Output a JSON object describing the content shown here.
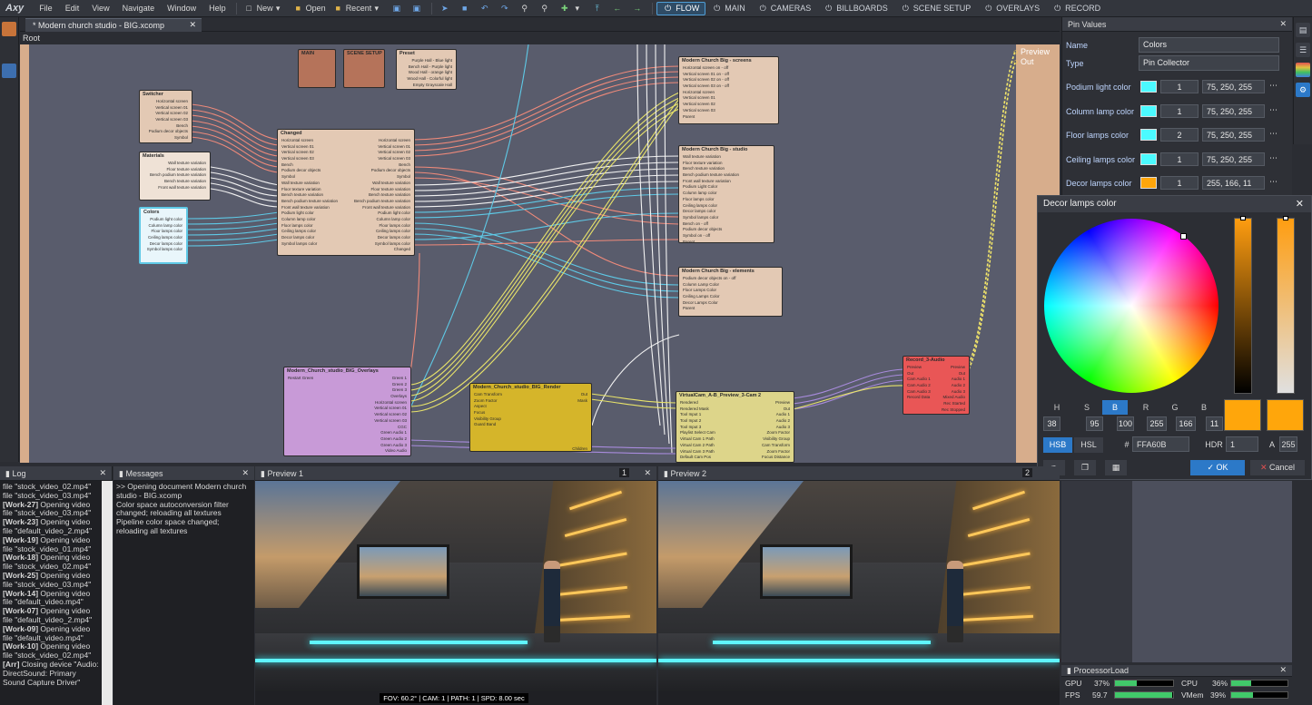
{
  "app": {
    "logo": "Axy"
  },
  "menu": [
    "File",
    "Edit",
    "View",
    "Navigate",
    "Window",
    "Help"
  ],
  "toolbar": {
    "new": "New",
    "open": "Open",
    "recent": "Recent"
  },
  "modes": [
    "FLOW",
    "MAIN",
    "CAMERAS",
    "BILLBOARDS",
    "SCENE SETUP",
    "OVERLAYS",
    "RECORD"
  ],
  "active_mode": "FLOW",
  "doc_tab": "* Modern church studio - BIG.xcomp",
  "breadcrumb": "Root",
  "flow": {
    "outputs": [
      "Preview",
      "Out"
    ],
    "nodes": {
      "main": "MAIN",
      "scene_setup": "SCENE SETUP",
      "preset": {
        "title": "Preset",
        "rows": [
          "Purple Hall - Blue light",
          "Bench Hall - Purple light",
          "Wood Hall - orange light",
          "Wood Hall - Colorful light",
          "Empty Grayscale Hall"
        ]
      },
      "switcher": {
        "title": "Switcher",
        "rows": [
          "Horizontal screen",
          "Vertical screen 01",
          "Vertical screen 02",
          "Vertical screen 03",
          "Bench",
          "Podium decor objects",
          "Symbol"
        ]
      },
      "materials": {
        "title": "Materials",
        "rows": [
          "Wall texture variation",
          "Floor texture variation",
          "Bench podium texture variation",
          "Bench texture variation",
          "Front wall texture variation"
        ]
      },
      "colors": {
        "title": "Colors",
        "rows": [
          "Podium light color",
          "Column lamp color",
          "Floor lamps color",
          "Ceiling lamps color",
          "Decor lamps color",
          "Symbol lamps color"
        ]
      },
      "changed": {
        "title": "Changed",
        "left": [
          "Horizontal screen",
          "Vertical screen 01",
          "Vertical screen 02",
          "Vertical screen 03",
          "Bench",
          "Podium decor objects",
          "Symbol",
          "Wall texture variation",
          "Floor texture variation",
          "Bench texture variation",
          "Bench podium texture variation",
          "Front wall texture variation",
          "Podium light color",
          "Column lamp color",
          "Floor lamps color",
          "Ceiling lamps color",
          "Decor lamps color",
          "Symbol lamps color"
        ],
        "right": [
          "Horizontal screen",
          "Vertical screen 01",
          "Vertical screen 02",
          "Vertical screen 03",
          "Bench",
          "Podium decor objects",
          "Symbol",
          "Wall texture variation",
          "Floor texture variation",
          "Bench texture variation",
          "Bench podium texture variation",
          "Front wall texture variation",
          "Podium light color",
          "Column lamp color",
          "Floor lamps color",
          "Ceiling lamps color",
          "Decor lamps color",
          "Symbol lamps color",
          "Changed"
        ]
      },
      "screens": {
        "title": "Modern Church Big - screens",
        "rows": [
          "Horizontal screen on - off",
          "Vertical screen 01 on - off",
          "Vertical screen 02 on - off",
          "Vertical screen 03 on - off",
          "Horizontal screen",
          "Vertical screen 01",
          "Vertical screen 02",
          "Vertical screen 03",
          "Parent"
        ]
      },
      "studio": {
        "title": "Modern Church Big - studio",
        "rows": [
          "Wall texture variation",
          "Floor texture variation",
          "Bench texture variation",
          "Bench podium texture variation",
          "Front wall texture variation",
          "Podium Light Color",
          "Column lamp color",
          "Floor lamps color",
          "Ceiling lamps color",
          "Decor lamps color",
          "Symbol lamps color",
          "Bench on - off",
          "Podium decor objects",
          "Symbol on - off",
          "Parent"
        ]
      },
      "elements": {
        "title": "Modern Church Big - elements",
        "rows": [
          "Podium decor objects on - off",
          "Column Lamp Color",
          "Floor Lamps Color",
          "Ceiling Lamps Color",
          "Decor Lamps Color",
          "Parent"
        ]
      },
      "overlays": {
        "title": "Modern_Church_studio_BIG_Overlays",
        "left": [
          "Restart Green"
        ],
        "right": [
          "Green 1",
          "Green 2",
          "Green 3",
          "Overlays",
          "Horizontal screen",
          "Vertical screen 01",
          "Vertical screen 02",
          "Vertical screen 03",
          "CGC",
          "Green Audio 1",
          "Green Audio 2",
          "Green Audio 3",
          "Video Audio"
        ]
      },
      "render": {
        "title": "Modern_Church_studio_BIG_Render",
        "left": [
          "Cam Transform",
          "Zoom Factor",
          "Aspect",
          "Focus",
          "Visibility Group",
          "Guard Band"
        ],
        "right": [
          "Out",
          "Mask",
          "",
          "",
          "",
          "",
          "",
          "",
          "",
          "Children",
          "Bindings",
          "Affecting Lights"
        ]
      },
      "vcam": {
        "title": "VirtualCam_A-B_Preview_3-Cam 2",
        "left": [
          "Rendered",
          "Rendered Mask",
          "Tool Input 1",
          "Tool Input 2",
          "Tool Input 3",
          "Playlist Select Cam",
          "Virtual Cam 1 Path",
          "Virtual Cam 2 Path",
          "Virtual Cam 3 Path",
          "Default Cam Pos"
        ],
        "right": [
          "Preview",
          "Out",
          "Audio 1",
          "Audio 2",
          "Audio 3",
          "Zoom Factor",
          "Visibility Group",
          "Cam Transform",
          "Zoom Factor",
          "Focus Distance"
        ]
      },
      "record": {
        "title": "Record_3-Audio",
        "left": [
          "Preview",
          "Out",
          "Cam Audio 1",
          "Cam Audio 2",
          "Cam Audio 3",
          "Record Data"
        ],
        "right": [
          "Preview",
          "Out",
          "Audio 1",
          "Audio 2",
          "Audio 3",
          "Mixed Audio",
          "Rec Started",
          "Rec Stopped"
        ]
      }
    }
  },
  "pin_values": {
    "title": "Pin Values",
    "name_label": "Name",
    "name_value": "Colors",
    "type_label": "Type",
    "type_value": "Pin Collector",
    "rows": [
      {
        "label": "Podium light color",
        "num": "1",
        "rgb": "75, 250, 255",
        "color": "#4bfaff"
      },
      {
        "label": "Column lamp color",
        "num": "1",
        "rgb": "75, 250, 255",
        "color": "#4bfaff"
      },
      {
        "label": "Floor lamps color",
        "num": "2",
        "rgb": "75, 250, 255",
        "color": "#4bfaff"
      },
      {
        "label": "Ceiling lamps color",
        "num": "1",
        "rgb": "75, 250, 255",
        "color": "#4bfaff"
      },
      {
        "label": "Decor lamps color",
        "num": "1",
        "rgb": "255, 166, 11",
        "color": "#ffa60b"
      }
    ]
  },
  "picker": {
    "title": "Decor lamps color",
    "labels": [
      "H",
      "S",
      "B",
      "R",
      "G",
      "B"
    ],
    "values": [
      "38",
      "95",
      "100",
      "255",
      "166",
      "11"
    ],
    "mode_hsb": "HSB",
    "mode_hsl": "HSL",
    "hash": "#",
    "hex": "FFA60B",
    "hdr_label": "HDR",
    "hdr_value": "1",
    "a_label": "A",
    "a_value": "255",
    "ok": "OK",
    "cancel": "Cancel",
    "color": "#ffa60b"
  },
  "log": {
    "title": "Log",
    "lines": [
      [
        "",
        "file \"stock_video_02.mp4\""
      ],
      [
        "",
        "file \"stock_video_03.mp4\""
      ],
      [
        "[Work-27]",
        " Opening video file \"stock_video_03.mp4\""
      ],
      [
        "[Work-23]",
        " Opening video file \"default_video_2.mp4\""
      ],
      [
        "[Work-19]",
        " Opening video file \"stock_video_01.mp4\""
      ],
      [
        "[Work-18]",
        " Opening video file \"stock_video_02.mp4\""
      ],
      [
        "[Work-25]",
        " Opening video file \"stock_video_03.mp4\""
      ],
      [
        "[Work-14]",
        " Opening video file \"default_video.mp4\""
      ],
      [
        "[Work-07]",
        " Opening video file \"default_video_2.mp4\""
      ],
      [
        "[Work-09]",
        " Opening video file \"default_video.mp4\""
      ],
      [
        "[Work-10]",
        " Opening video file \"stock_video_02.mp4\""
      ],
      [
        "[Arr]",
        " Closing device \"Audio: DirectSound: Primary Sound Capture Driver\""
      ]
    ]
  },
  "messages": {
    "title": "Messages",
    "lines": [
      ">> Opening document Modern church studio - BIG.xcomp",
      "Color space autoconversion filter changed; reloading all textures",
      "Pipeline color space changed; reloading all textures"
    ]
  },
  "preview1": {
    "title": "Preview 1",
    "num": "1",
    "status": "FOV: 60.2° | CAM: 1 | PATH: 1 | SPD: 8.00 sec"
  },
  "preview2": {
    "title": "Preview 2",
    "num": "2"
  },
  "processor": {
    "title": "ProcessorLoad",
    "gpu_label": "GPU",
    "gpu": "37%",
    "gpu_frac": 0.37,
    "cpu_label": "CPU",
    "cpu": "36%",
    "cpu_frac": 0.36,
    "fps_label": "FPS",
    "fps": "59.7",
    "fps_frac": 0.99,
    "vmem_label": "VMem",
    "vmem": "39%",
    "vmem_frac": 0.39
  }
}
